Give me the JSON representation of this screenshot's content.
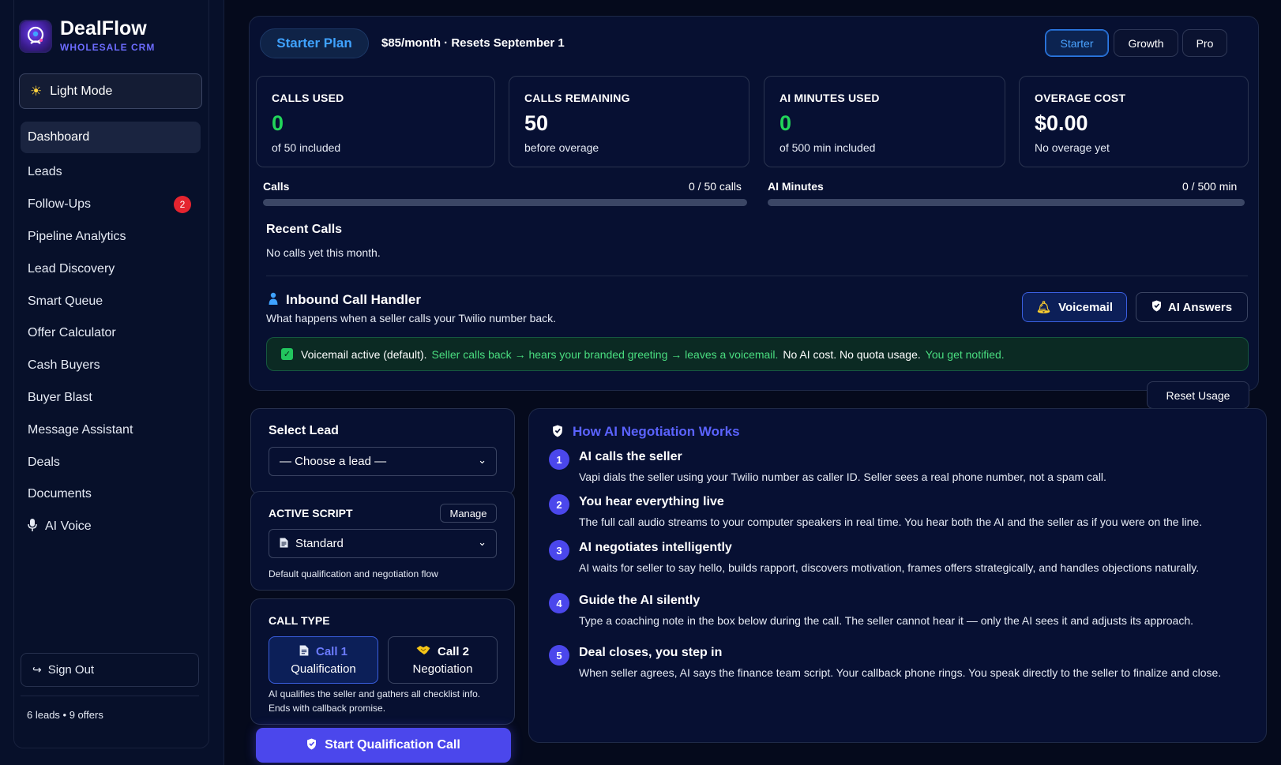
{
  "brand": {
    "name": "DealFlow",
    "subtitle": "WHOLESALE CRM"
  },
  "sidebar": {
    "light_mode_label": "Light Mode",
    "items": [
      {
        "label": "Dashboard",
        "active": true
      },
      {
        "label": "Leads"
      },
      {
        "label": "Follow-Ups",
        "badge": "2"
      },
      {
        "label": "Pipeline Analytics"
      },
      {
        "label": "Lead Discovery"
      },
      {
        "label": "Smart Queue"
      },
      {
        "label": "Offer Calculator"
      },
      {
        "label": "Cash Buyers"
      },
      {
        "label": "Buyer Blast"
      },
      {
        "label": "Message Assistant"
      },
      {
        "label": "Deals"
      },
      {
        "label": "Documents"
      },
      {
        "label": "AI Voice",
        "icon": "microphone-icon"
      }
    ],
    "sign_out_label": "Sign Out",
    "stats": "6 leads • 9 offers"
  },
  "plan": {
    "name": "Starter Plan",
    "info": "$85/month · Resets September 1",
    "tiers": [
      "Starter",
      "Growth",
      "Pro"
    ],
    "active_tier": "Starter"
  },
  "stats": [
    {
      "label": "CALLS USED",
      "value": "0",
      "sub": "of 50 included",
      "color": "#22d55a"
    },
    {
      "label": "CALLS REMAINING",
      "value": "50",
      "sub": "before overage",
      "color": "#ffffff"
    },
    {
      "label": "AI MINUTES USED",
      "value": "0",
      "sub": "of 500 min included",
      "color": "#22d55a"
    },
    {
      "label": "OVERAGE COST",
      "value": "$0.00",
      "sub": "No overage yet",
      "color": "#ffffff"
    }
  ],
  "usage_bars": {
    "calls": {
      "label": "Calls",
      "count": "0 / 50 calls",
      "fraction": 0
    },
    "ai_minutes": {
      "label": "AI Minutes",
      "count": "0 / 500 min",
      "fraction": 0
    }
  },
  "recent_calls": {
    "title": "Recent Calls",
    "empty": "No calls yet this month."
  },
  "inbound": {
    "title": "Inbound Call Handler",
    "subtitle": "What happens when a seller calls your Twilio number back.",
    "voicemail_label": "Voicemail",
    "ai_answers_label": "AI Answers",
    "banner": {
      "lead": "Voicemail active (default).",
      "flow": "Seller calls back → hears your branded greeting → leaves a voicemail.",
      "cost": "No AI cost. No quota usage.",
      "notify": "You get notified."
    }
  },
  "reset_usage_label": "Reset Usage",
  "lead_select": {
    "title": "Select Lead",
    "value": "— Choose a lead —"
  },
  "script": {
    "label": "ACTIVE SCRIPT",
    "manage_label": "Manage",
    "value": "Standard",
    "description": "Default qualification and negotiation flow"
  },
  "call_type": {
    "label": "CALL TYPE",
    "options": [
      {
        "top": "Call 1",
        "bottom": "Qualification",
        "icon": "document-icon",
        "active": true
      },
      {
        "top": "Call 2",
        "bottom": "Negotiation",
        "icon": "handshake-icon",
        "active": false
      }
    ],
    "description": "AI qualifies the seller and gathers all checklist info. Ends with callback promise."
  },
  "start_button_label": "Start Qualification Call",
  "how_it_works": {
    "title": "How AI Negotiation Works",
    "steps": [
      {
        "num": "1",
        "title": "AI calls the seller",
        "desc": "Vapi dials the seller using your Twilio number as caller ID. Seller sees a real phone number, not a spam call."
      },
      {
        "num": "2",
        "title": "You hear everything live",
        "desc": "The full call audio streams to your computer speakers in real time. You hear both the AI and the seller as if you were on the line."
      },
      {
        "num": "3",
        "title": "AI negotiates intelligently",
        "desc": "AI waits for seller to say hello, builds rapport, discovers motivation, frames offers strategically, and handles objections naturally."
      },
      {
        "num": "4",
        "title": "Guide the AI silently",
        "desc": "Type a coaching note in the box below during the call. The seller cannot hear it — only the AI sees it and adjusts its approach."
      },
      {
        "num": "5",
        "title": "Deal closes, you step in",
        "desc": "When seller agrees, AI says the finance team script. Your callback phone rings. You speak directly to the seller to finalize and close."
      }
    ]
  }
}
